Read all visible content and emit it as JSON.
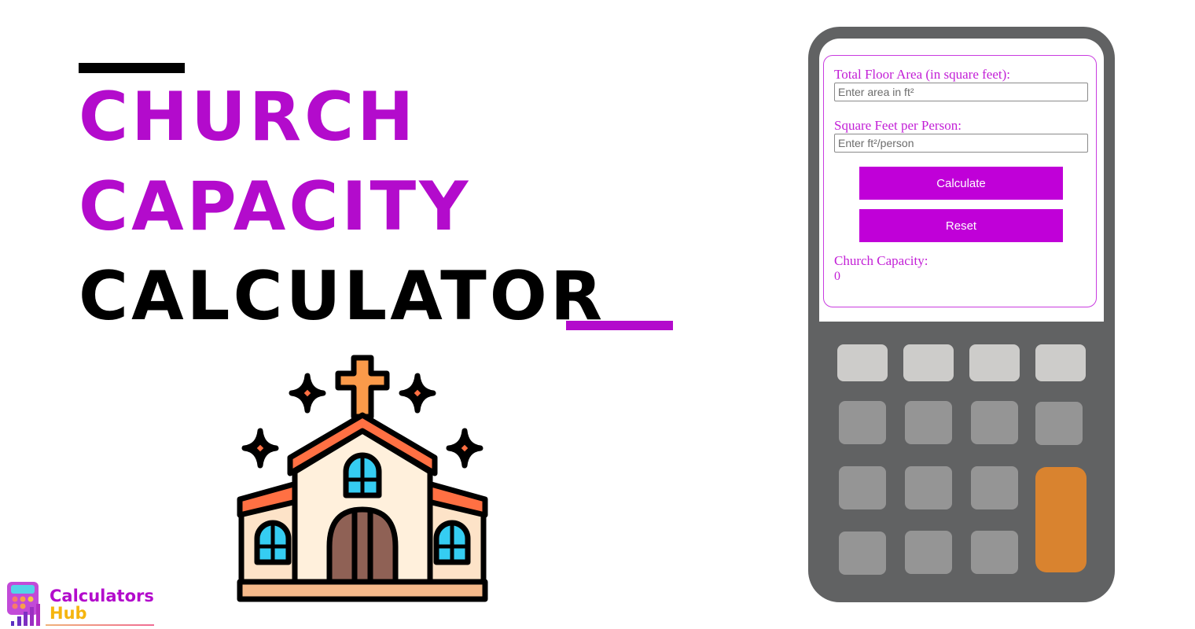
{
  "headline": {
    "line1": "CHURCH",
    "line2": "CAPACITY",
    "line3": "CALCULATOR",
    "accent_color": "#b30bcc"
  },
  "logo": {
    "line1": "Calculators",
    "line2": "Hub"
  },
  "calculator": {
    "fields": [
      {
        "label": "Total Floor Area (in square feet):",
        "placeholder": "Enter area in ft²",
        "value": ""
      },
      {
        "label": "Square Feet per Person:",
        "placeholder": "Enter ft²/person",
        "value": ""
      }
    ],
    "buttons": {
      "calculate": "Calculate",
      "reset": "Reset"
    },
    "result": {
      "label": "Church Capacity:",
      "value": "0"
    },
    "button_color": "#c000d8"
  },
  "icons": {
    "illustration": "church-icon",
    "logo": "calculator-icon"
  }
}
